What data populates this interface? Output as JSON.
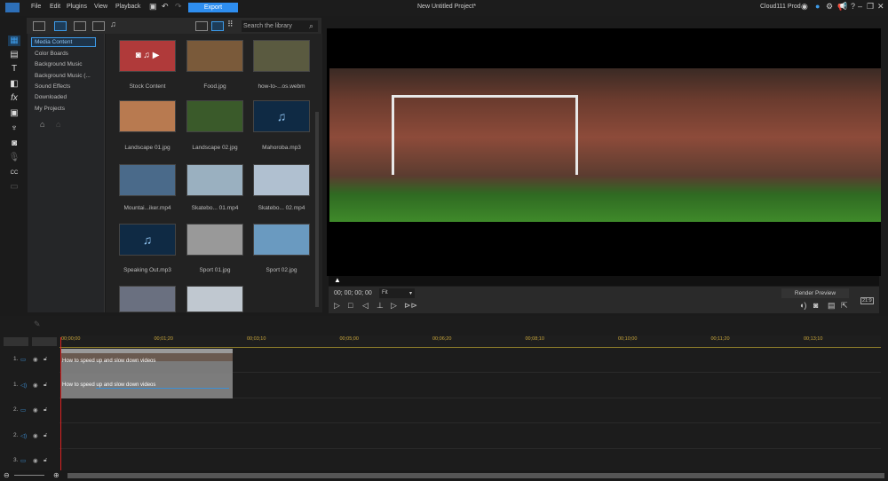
{
  "menu": {
    "file": "File",
    "edit": "Edit",
    "plugins": "Plugins",
    "view": "View",
    "playback": "Playback",
    "export": "Export",
    "title": "New Untitled Project*",
    "user": "Cloud111 Prod"
  },
  "library": {
    "search_placeholder": "Search the library",
    "rooms": [
      "Media Content",
      "Color Boards",
      "Background Music",
      "Background Music (...",
      "Sound Effects",
      "Downloaded",
      "My Projects"
    ],
    "items": [
      "Stock Content",
      "Food.jpg",
      "how-to-...os.webm",
      "Landscape 01.jpg",
      "Landscape 02.jpg",
      "Mahoroba.mp3",
      "Mountai...iker.mp4",
      "Skatebo... 01.mp4",
      "Skatebo... 02.mp4",
      "Speaking Out.mp3",
      "Sport 01.jpg",
      "Sport 02.jpg",
      "",
      ""
    ]
  },
  "preview": {
    "timecode": "00; 00; 00; 00",
    "zoom": "Fit",
    "render": "Render Preview",
    "aspect": "21:9"
  },
  "timeline": {
    "ruler": [
      "00;00;00",
      "00;01;20",
      "00;03;10",
      "00;05;00",
      "00;06;20",
      "00;08;10",
      "00;10;00",
      "00;11;20",
      "00;13;10"
    ],
    "tracks": [
      "1.",
      "1.",
      "2.",
      "2.",
      "3."
    ],
    "clip_video": "How to speed up and slow down videos",
    "clip_audio": "How to speed up and slow down videos"
  },
  "colors": {
    "accent": "#2e8ef0",
    "playhead": "#dd2222"
  }
}
